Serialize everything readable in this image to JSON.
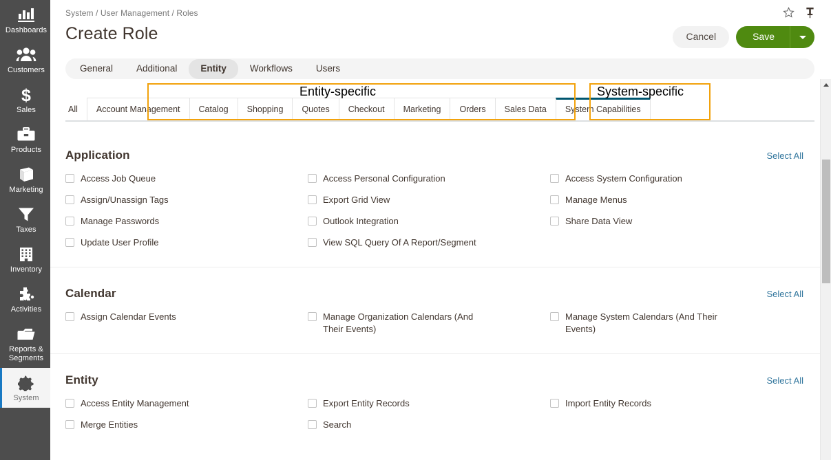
{
  "sidebar": {
    "items": [
      {
        "label": "Dashboards",
        "icon": "bar-chart-icon",
        "active": false
      },
      {
        "label": "Customers",
        "icon": "people-icon",
        "active": false
      },
      {
        "label": "Sales",
        "icon": "dollar-icon",
        "active": false
      },
      {
        "label": "Products",
        "icon": "briefcase-icon",
        "active": false
      },
      {
        "label": "Marketing",
        "icon": "book-icon",
        "active": false
      },
      {
        "label": "Taxes",
        "icon": "funnel-icon",
        "active": false
      },
      {
        "label": "Inventory",
        "icon": "building-icon",
        "active": false
      },
      {
        "label": "Activities",
        "icon": "puzzle-icon",
        "active": false
      },
      {
        "label": "Reports & Segments",
        "icon": "folder-icon",
        "active": false
      },
      {
        "label": "System",
        "icon": "gear-icon",
        "active": true
      }
    ],
    "active_accent": "#1979c3",
    "background": "#4d4d4d"
  },
  "header": {
    "breadcrumb": "System / User Management / Roles",
    "title": "Create Role",
    "favorite_icon": "star-icon",
    "pin_icon": "pin-icon",
    "cancel_label": "Cancel",
    "save_label": "Save",
    "save_dropdown_icon": "chevron-down-icon",
    "save_color": "#4f8a10"
  },
  "primary_tabs": [
    {
      "label": "General",
      "active": false
    },
    {
      "label": "Additional",
      "active": false
    },
    {
      "label": "Entity",
      "active": true
    },
    {
      "label": "Workflows",
      "active": false
    },
    {
      "label": "Users",
      "active": false
    }
  ],
  "sub_tabs": [
    {
      "label": "All",
      "style": "plain",
      "active": false
    },
    {
      "label": "Account Management",
      "style": "boxed",
      "active": false
    },
    {
      "label": "Catalog",
      "style": "boxed",
      "active": false
    },
    {
      "label": "Shopping",
      "style": "boxed",
      "active": false
    },
    {
      "label": "Quotes",
      "style": "boxed",
      "active": false
    },
    {
      "label": "Checkout",
      "style": "boxed",
      "active": false
    },
    {
      "label": "Marketing",
      "style": "boxed",
      "active": false
    },
    {
      "label": "Orders",
      "style": "boxed",
      "active": false
    },
    {
      "label": "Sales Data",
      "style": "boxed",
      "active": false
    },
    {
      "label": "System Capabilities",
      "style": "boxed",
      "active": true
    }
  ],
  "annotations": {
    "color": "#f2a20c",
    "entity_specific_label": "Entity-specific",
    "system_specific_label": "System-specific"
  },
  "sections": [
    {
      "title": "Application",
      "select_all": "Select All",
      "checkboxes": [
        {
          "label": "Access Job Queue",
          "checked": false
        },
        {
          "label": "Access Personal Configuration",
          "checked": false
        },
        {
          "label": "Access System Configuration",
          "checked": false
        },
        {
          "label": "Assign/Unassign Tags",
          "checked": false
        },
        {
          "label": "Export Grid View",
          "checked": false
        },
        {
          "label": "Manage Menus",
          "checked": false
        },
        {
          "label": "Manage Passwords",
          "checked": false
        },
        {
          "label": "Outlook Integration",
          "checked": false
        },
        {
          "label": "Share Data View",
          "checked": false
        },
        {
          "label": "Update User Profile",
          "checked": false
        },
        {
          "label": "View SQL Query Of A Report/Segment",
          "checked": false
        }
      ]
    },
    {
      "title": "Calendar",
      "select_all": "Select All",
      "checkboxes": [
        {
          "label": "Assign Calendar Events",
          "checked": false
        },
        {
          "label": "Manage Organization Calendars (And Their Events)",
          "checked": false
        },
        {
          "label": "Manage System Calendars (And Their Events)",
          "checked": false
        }
      ]
    },
    {
      "title": "Entity",
      "select_all": "Select All",
      "checkboxes": [
        {
          "label": "Access Entity Management",
          "checked": false
        },
        {
          "label": "Export Entity Records",
          "checked": false
        },
        {
          "label": "Import Entity Records",
          "checked": false
        },
        {
          "label": "Merge Entities",
          "checked": false
        },
        {
          "label": "Search",
          "checked": false
        }
      ]
    }
  ],
  "scrollbar": {
    "up_arrow_icon": "caret-up-icon"
  }
}
